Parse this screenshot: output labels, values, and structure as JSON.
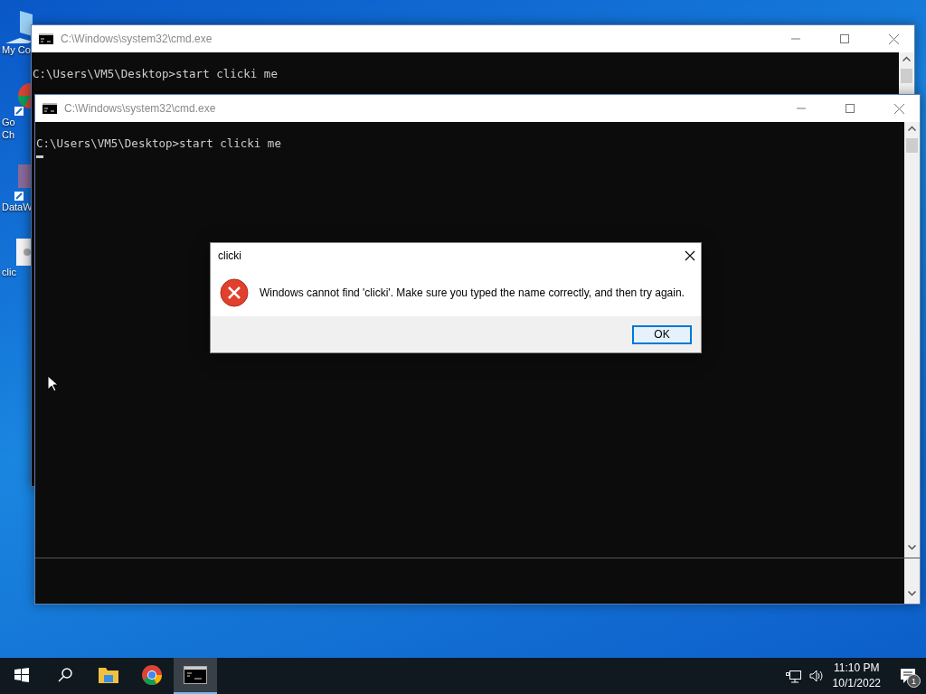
{
  "desktop_icons": [
    {
      "lines": [
        "My Co"
      ],
      "kind": "computer"
    },
    {
      "lines": [
        "Go",
        "Ch"
      ],
      "kind": "chrome"
    },
    {
      "lines": [
        "DataW"
      ],
      "kind": "data"
    },
    {
      "lines": [
        "clic"
      ],
      "kind": "file"
    }
  ],
  "windows": [
    {
      "title": "C:\\Windows\\system32\\cmd.exe",
      "lines": [
        "C:\\Users\\VM5\\Desktop>start clicki me"
      ],
      "cursor": false,
      "split": false
    },
    {
      "title": "C:\\Windows\\system32\\cmd.exe",
      "lines": [
        "C:\\Users\\VM5\\Desktop>start clicki me"
      ],
      "cursor": true,
      "split": true
    }
  ],
  "dialog": {
    "title": "clicki",
    "message": "Windows cannot find 'clicki'. Make sure you typed the name correctly, and then try again.",
    "button": "OK"
  },
  "taskbar": {
    "apps": [
      {
        "kind": "explorer",
        "selected": false
      },
      {
        "kind": "chrome",
        "selected": false
      },
      {
        "kind": "cmd",
        "selected": true
      }
    ],
    "time": "11:10 PM",
    "date": "10/1/2022",
    "notifications": "1"
  }
}
